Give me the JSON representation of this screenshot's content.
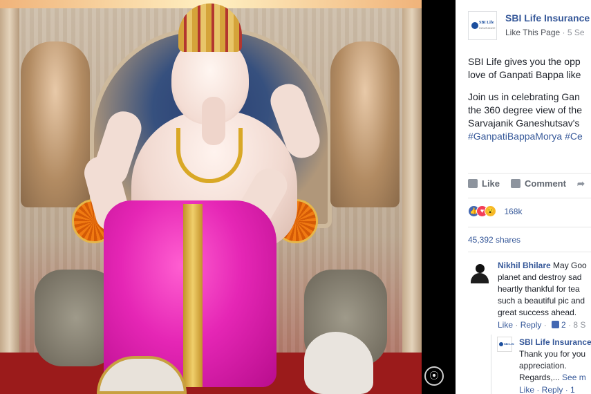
{
  "viewer": {
    "degree_icon_glyph": "⦿"
  },
  "page": {
    "logo_text": "SBI Life",
    "logo_sub": "INSURANCE",
    "name": "SBI Life Insurance",
    "like_label": "Like This Page",
    "separator": " · ",
    "time": "5 Se"
  },
  "post": {
    "para1_line1": "SBI Life gives you the opp",
    "para1_line2": "love of Ganpati Bappa like",
    "para2_line1": "Join us in celebrating Gan",
    "para2_line2": "the 360 degree view of the",
    "para2_line3": "Sarvajanik Ganeshutsav's",
    "hashtags": "#GanpatiBappaMorya #Ce"
  },
  "actions": {
    "like": "Like",
    "comment": "Comment",
    "share_glyph": "➦"
  },
  "reactions": {
    "types": [
      "like",
      "love",
      "wow"
    ],
    "like_glyph": "👍",
    "love_glyph": "♥",
    "wow_glyph": "😮",
    "count": "168k"
  },
  "shares": "45,392 shares",
  "comment": {
    "author": "Nikhil Bhilare",
    "line1": " May Goo",
    "line2": "planet and destroy sad",
    "line3": "heartly thankful for tea",
    "line4": "such a beautiful pic and",
    "line5": "great success ahead.",
    "like": "Like",
    "dot": " · ",
    "reply": "Reply",
    "like_count": "2",
    "time": "8 S"
  },
  "reply": {
    "avatar_text": "SBI Life",
    "author": "SBI Life Insurance",
    "line1": "Thank you for you",
    "line2": "appreciation.",
    "line3": "Regards,...",
    "see_more": " See m",
    "footer_cut": "Like · Reply · 1"
  },
  "colors": {
    "link_blue": "#365899",
    "brand_blue": "#1c4f9e",
    "dhoti_pink": "#e526b5"
  }
}
